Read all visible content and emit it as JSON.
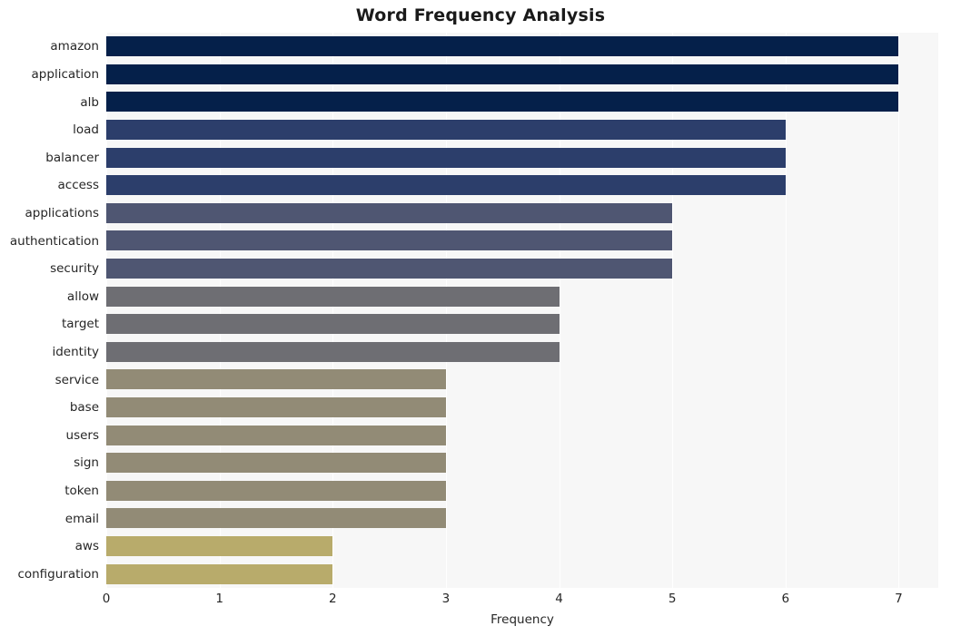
{
  "chart_data": {
    "type": "bar",
    "orientation": "horizontal",
    "title": "Word Frequency Analysis",
    "xlabel": "Frequency",
    "ylabel": "",
    "xlim": [
      0,
      7.35
    ],
    "xticks": [
      0,
      1,
      2,
      3,
      4,
      5,
      6,
      7
    ],
    "grid": true,
    "grid_axis": "x",
    "legend": null,
    "categories": [
      "amazon",
      "application",
      "alb",
      "load",
      "balancer",
      "access",
      "applications",
      "authentication",
      "security",
      "allow",
      "target",
      "identity",
      "service",
      "base",
      "users",
      "sign",
      "token",
      "email",
      "aws",
      "configuration"
    ],
    "values": [
      7,
      7,
      7,
      6,
      6,
      6,
      5,
      5,
      5,
      4,
      4,
      4,
      3,
      3,
      3,
      3,
      3,
      3,
      2,
      2
    ],
    "bar_colors": [
      "#05204a",
      "#05204a",
      "#05204a",
      "#2c3e6b",
      "#2c3e6b",
      "#2c3e6b",
      "#4f5672",
      "#4f5672",
      "#4f5672",
      "#6e6e73",
      "#6e6e73",
      "#6e6e73",
      "#928b76",
      "#928b76",
      "#928b76",
      "#928b76",
      "#928b76",
      "#928b76",
      "#b8ab6b",
      "#b8ab6b"
    ],
    "plot_background": "#f7f7f7",
    "gridline_color": "#ffffff",
    "figure_background": "#ffffff"
  }
}
